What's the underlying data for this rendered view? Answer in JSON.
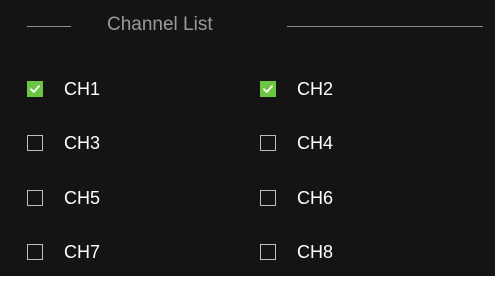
{
  "panel": {
    "title": "Channel List"
  },
  "channels": [
    {
      "label": "CH1",
      "checked": true
    },
    {
      "label": "CH2",
      "checked": true
    },
    {
      "label": "CH3",
      "checked": false
    },
    {
      "label": "CH4",
      "checked": false
    },
    {
      "label": "CH5",
      "checked": false
    },
    {
      "label": "CH6",
      "checked": false
    },
    {
      "label": "CH7",
      "checked": false
    },
    {
      "label": "CH8",
      "checked": false
    }
  ],
  "colors": {
    "background": "#141414",
    "checked_fill": "#6cc644",
    "label_text": "#ffffff",
    "legend_text": "#9a9a9a"
  },
  "icons": {
    "checked": "checkmark-icon"
  }
}
